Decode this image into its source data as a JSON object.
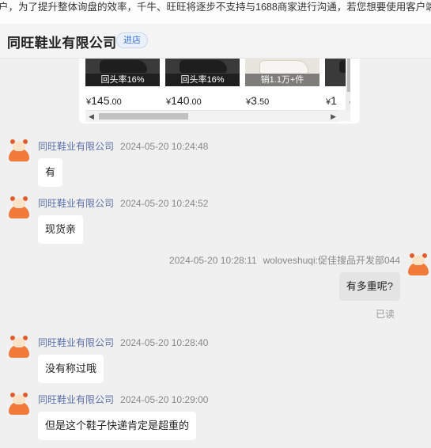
{
  "notice": {
    "text": "户，为了提升整体询盘的效率，千牛、旺旺将逐步不支持与1688商家进行沟通，若您想要使用客户端进行"
  },
  "header": {
    "shop_name": "同旺鞋业有限公司",
    "enter_label": "进店"
  },
  "products": [
    {
      "tag": "回头率16%",
      "currency": "¥",
      "price_main": "145",
      "price_cents": ".00",
      "style": "dark"
    },
    {
      "tag": "回头率16%",
      "currency": "¥",
      "price_main": "140",
      "price_cents": ".00",
      "style": "dark"
    },
    {
      "tag": "销1.1万+件",
      "currency": "¥",
      "price_main": "3",
      "price_cents": ".50",
      "style": "light"
    },
    {
      "tag": "",
      "currency": "¥",
      "price_main": "1",
      "price_cents": "",
      "style": "dark"
    }
  ],
  "messages": [
    {
      "sender": "同旺鞋业有限公司",
      "time": "2024-05-20 10:24:48",
      "text": "有"
    },
    {
      "sender": "同旺鞋业有限公司",
      "time": "2024-05-20 10:24:52",
      "text": "现货亲"
    },
    {
      "sender": "woloveshuqi:促佳搜品开发部044",
      "time": "2024-05-20 10:28:11",
      "text": "有多重呢?",
      "status": "已读"
    },
    {
      "sender": "同旺鞋业有限公司",
      "time": "2024-05-20 10:28:40",
      "text": "没有称过哦"
    },
    {
      "sender": "同旺鞋业有限公司",
      "time": "2024-05-20 10:29:00",
      "text": "但是这个鞋子快递肯定是超重的"
    }
  ],
  "icons": [
    "chevron-left-icon",
    "chevron-right-icon",
    "chevron-down-icon",
    "avatar-icon"
  ]
}
